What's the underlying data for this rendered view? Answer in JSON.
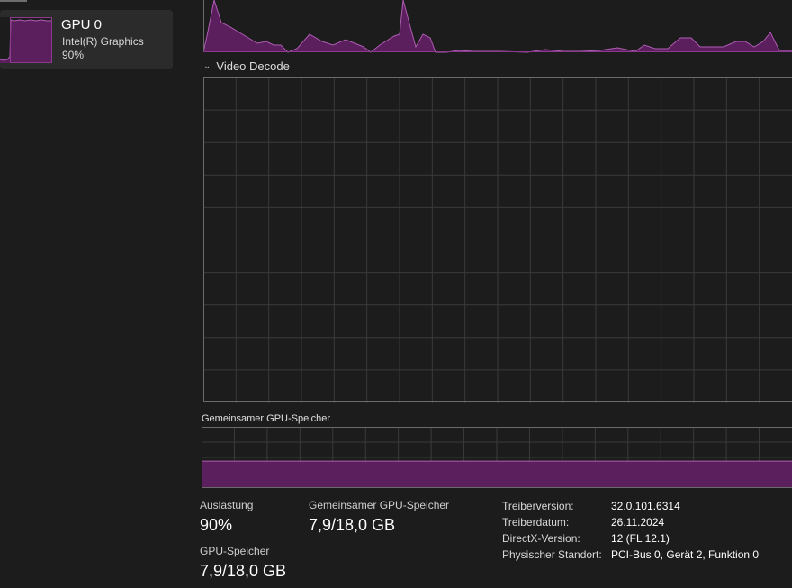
{
  "sidebar": {
    "gpu_item": {
      "title": "GPU 0",
      "subtitle": "Intel(R) Graphics",
      "usage": "90%"
    }
  },
  "graphs": {
    "video_decode_label": "Video Decode",
    "shared_memory_label": "Gemeinsamer GPU-Speicher",
    "accent_color": "#8b3a8e",
    "fill_color": "#5a1f5c",
    "grid_color": "#3a3a3a",
    "shared_memory_fill_fraction": 0.44
  },
  "stats": {
    "utilization_label": "Auslastung",
    "utilization_value": "90%",
    "gpu_memory_label": "GPU-Speicher",
    "gpu_memory_value": "7,9/18,0 GB",
    "shared_memory_label": "Gemeinsamer GPU-Speicher",
    "shared_memory_value": "7,9/18,0 GB"
  },
  "properties": [
    {
      "key": "Treiberversion:",
      "value": "32.0.101.6314"
    },
    {
      "key": "Treiberdatum:",
      "value": "26.11.2024"
    },
    {
      "key": "DirectX-Version:",
      "value": "12 (FL 12.1)"
    },
    {
      "key": "Physischer Standort:",
      "value": "PCI-Bus 0, Gerät 2, Funktion 0"
    }
  ]
}
